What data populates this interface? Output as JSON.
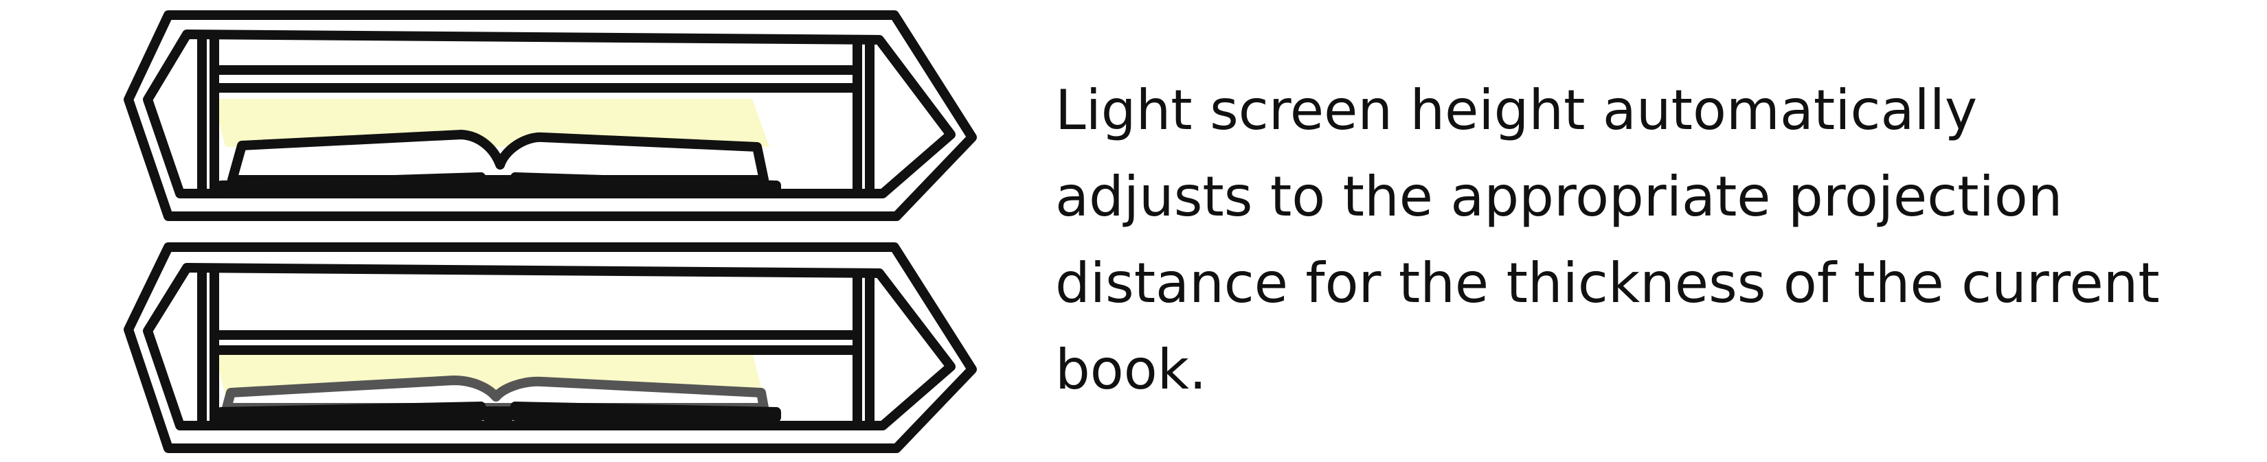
{
  "colors": {
    "stroke": "#111111",
    "light": "#fafac8",
    "background": "#ffffff"
  },
  "caption": {
    "text": "Light screen height automatically\nadjusts to the appropriate projection\ndistance for the thickness of the current\nbook."
  }
}
